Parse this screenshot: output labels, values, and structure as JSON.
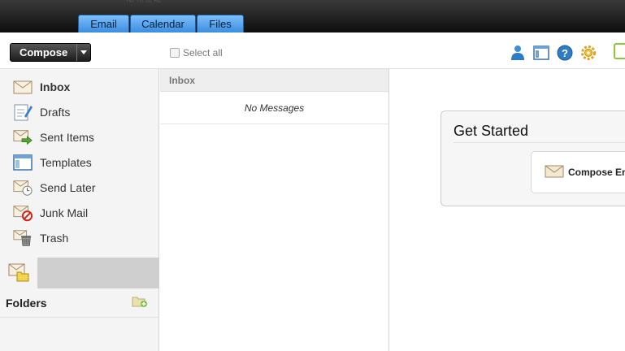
{
  "topbar": {
    "faint_text": "ᴴᴰ ᵀᴰ ᶻᴱ ᴷᴱ",
    "tabs": [
      {
        "label": "Email"
      },
      {
        "label": "Calendar"
      },
      {
        "label": "Files"
      }
    ]
  },
  "toolbar": {
    "compose_label": "Compose",
    "select_all_label": "Select all",
    "icons": [
      "contacts-icon",
      "layout-icon",
      "help-icon",
      "settings-icon"
    ]
  },
  "sidebar": {
    "items": [
      {
        "label": "Inbox",
        "icon": "inbox-icon"
      },
      {
        "label": "Drafts",
        "icon": "drafts-icon"
      },
      {
        "label": "Sent Items",
        "icon": "sent-icon"
      },
      {
        "label": "Templates",
        "icon": "templates-icon"
      },
      {
        "label": "Send Later",
        "icon": "send-later-icon"
      },
      {
        "label": "Junk Mail",
        "icon": "junk-icon"
      },
      {
        "label": "Trash",
        "icon": "trash-icon"
      }
    ],
    "folders_title": "Folders"
  },
  "message_list": {
    "header": "Inbox",
    "empty_text": "No Messages"
  },
  "get_started": {
    "title": "Get Started",
    "card_label": "Compose Em"
  },
  "colors": {
    "tab_blue": "#3b8de0",
    "topbar": "#111111",
    "accent_green": "#8cc63f"
  }
}
